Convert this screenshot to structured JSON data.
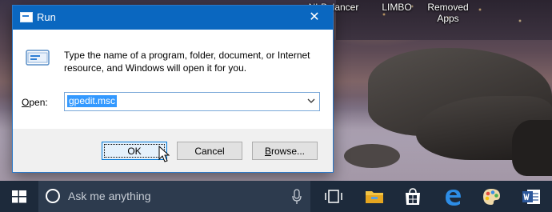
{
  "desktop": {
    "icons": [
      {
        "label": "NLBalancer"
      },
      {
        "label": "LIMBO"
      },
      {
        "label": "Removed Apps"
      }
    ]
  },
  "run_dialog": {
    "title": "Run",
    "close_glyph": "✕",
    "description": "Type the name of a program, folder, document, or Internet resource, and Windows will open it for you.",
    "open_label_accel": "O",
    "open_label_rest": "pen:",
    "open_value": "gpedit.msc",
    "buttons": {
      "ok": "OK",
      "cancel": "Cancel",
      "browse_accel": "B",
      "browse_rest": "rowse..."
    }
  },
  "taskbar": {
    "search_placeholder": "Ask me anything",
    "pinned": [
      "task-view-icon",
      "file-explorer-icon",
      "store-icon",
      "edge-icon",
      "paint-icon",
      "word-icon"
    ]
  },
  "colors": {
    "titlebar": "#0a67c0",
    "taskbar": "#1d2a3b",
    "selection": "#3399ff"
  }
}
